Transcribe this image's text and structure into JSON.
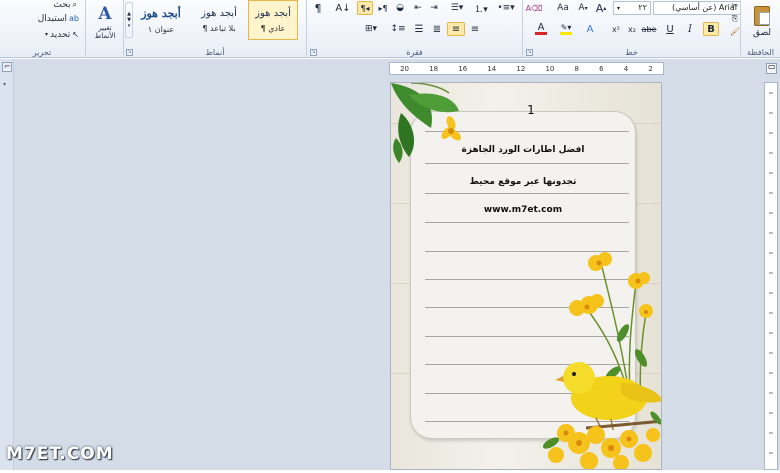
{
  "ribbon": {
    "clipboard": {
      "paste_label": "لصق",
      "group_label": "الحافظة"
    },
    "font": {
      "font_name": "Arial (عن أساسي)",
      "font_size": "٢٢",
      "group_label": "خط",
      "bold_label": "B",
      "italic_label": "I",
      "underline_label": "U",
      "strike_label": "abe",
      "subscript_label": "x₂",
      "superscript_label": "x²",
      "grow_label": "A",
      "shrink_label": "A",
      "case_label": "Aa",
      "font_color_label": "A"
    },
    "paragraph": {
      "group_label": "فقرة",
      "pilcrow_label": "¶",
      "sort_label": "↕"
    },
    "styles": {
      "group_label": "أنماط",
      "items": [
        {
          "preview": "أبجد هوز",
          "name": "¶ عادي"
        },
        {
          "preview": "أبجد هوز",
          "name": "¶ بلا تباعد"
        },
        {
          "preview": "أبجد هوز",
          "name": "عنوان ١"
        }
      ],
      "change_styles_label": "تغيير الأنماط"
    },
    "editing": {
      "group_label": "تحرير",
      "find_label": "بحث",
      "replace_label": "استبدال",
      "select_label": "تحديد"
    }
  },
  "document": {
    "page_number": "1",
    "line1": "افضل اطارات الورد الجاهزة",
    "line2": "تجدونها عبر موقع محيط",
    "line3": "www.m7et.com"
  },
  "ruler": {
    "ticks": [
      "20",
      "18",
      "16",
      "14",
      "12",
      "10",
      "8",
      "6",
      "4",
      "2"
    ]
  },
  "watermark": "M7ET.COM",
  "colors": {
    "ribbon_bg": "#e8eef6",
    "workspace_bg": "#d4dce7",
    "accent_selected": "#ffe9a8",
    "font_color_red": "#d8262a",
    "highlight_yellow": "#ffe600",
    "petal_yellow": "#f6c21c",
    "leaf_green": "#3f8a2c"
  }
}
